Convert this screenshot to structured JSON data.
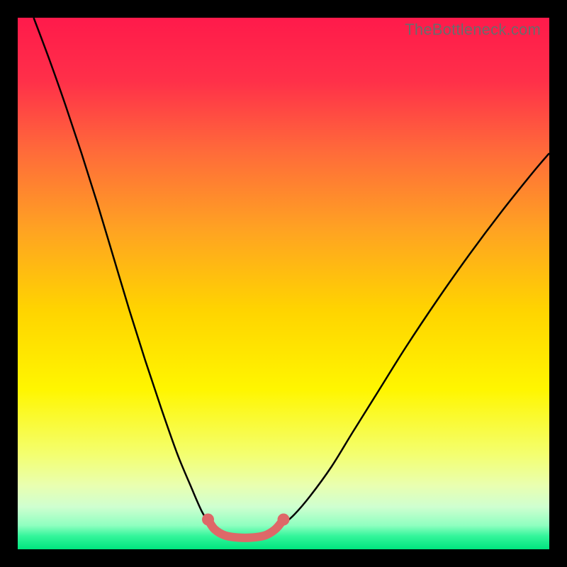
{
  "watermark": "TheBottleneck.com",
  "chart_data": {
    "type": "line",
    "title": "",
    "xlabel": "",
    "ylabel": "",
    "xlim": [
      0,
      100
    ],
    "ylim": [
      0,
      100
    ],
    "grid": false,
    "background_gradient": {
      "stops": [
        {
          "pos": 0.0,
          "color": "#ff1a4b"
        },
        {
          "pos": 0.12,
          "color": "#ff3049"
        },
        {
          "pos": 0.25,
          "color": "#ff6a3a"
        },
        {
          "pos": 0.4,
          "color": "#ffa322"
        },
        {
          "pos": 0.55,
          "color": "#ffd400"
        },
        {
          "pos": 0.7,
          "color": "#fff600"
        },
        {
          "pos": 0.82,
          "color": "#f4ff6e"
        },
        {
          "pos": 0.88,
          "color": "#e9ffb0"
        },
        {
          "pos": 0.92,
          "color": "#cfffd0"
        },
        {
          "pos": 0.955,
          "color": "#8fffc0"
        },
        {
          "pos": 0.975,
          "color": "#34f59b"
        },
        {
          "pos": 1.0,
          "color": "#00e57e"
        }
      ]
    },
    "series": [
      {
        "name": "left-curve",
        "color": "#000000",
        "width": 2.5,
        "x": [
          3,
          6,
          9,
          12,
          15,
          18,
          21,
          24,
          27,
          30,
          32.5,
          34.7,
          36.5
        ],
        "y": [
          100,
          92,
          83.5,
          74.5,
          65,
          55,
          45,
          35.5,
          26.5,
          18,
          12,
          7,
          4.3
        ]
      },
      {
        "name": "right-curve",
        "color": "#000000",
        "width": 2.5,
        "x": [
          49.5,
          52,
          55,
          59,
          63,
          68,
          73,
          79,
          85,
          91,
          97,
          100
        ],
        "y": [
          4.3,
          6.5,
          10,
          15.5,
          22,
          30,
          38,
          47,
          55.5,
          63.5,
          71,
          74.5
        ]
      },
      {
        "name": "valley-marker",
        "color": "#de6868",
        "width": 12,
        "linecap": "round",
        "x": [
          35.8,
          37.0,
          39.0,
          41.5,
          44.0,
          46.5,
          48.5,
          50.0
        ],
        "y": [
          5.6,
          3.8,
          2.6,
          2.2,
          2.2,
          2.6,
          3.8,
          5.6
        ]
      }
    ],
    "valley_endpoints": [
      {
        "x": 35.8,
        "y": 5.6
      },
      {
        "x": 50.0,
        "y": 5.6
      }
    ]
  }
}
